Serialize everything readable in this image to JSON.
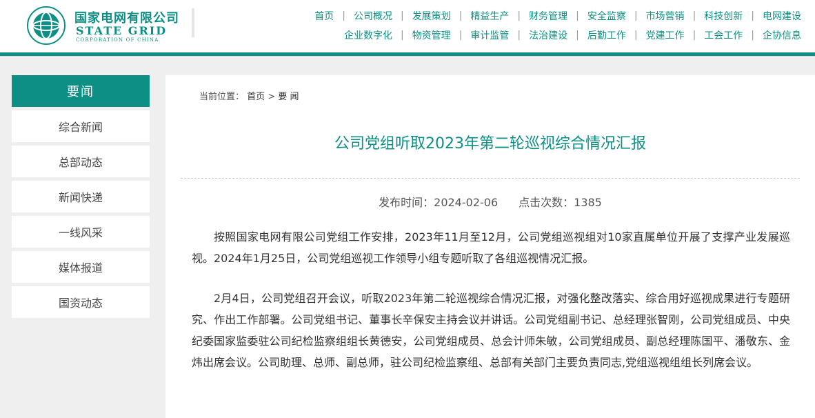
{
  "brand": {
    "name_cn": "国家电网有限公司",
    "name_en": "STATE GRID",
    "name_en_sub": "CORPORATION OF CHINA",
    "color": "#0e8f86"
  },
  "nav": {
    "row1": [
      "首页",
      "公司概况",
      "发展策划",
      "精益生产",
      "财务管理",
      "安全监察",
      "市场营销",
      "科技创新",
      "电网建设"
    ],
    "row2": [
      "企业数字化",
      "物资管理",
      "审计监管",
      "法治建设",
      "后勤工作",
      "党建工作",
      "工会工作",
      "企协信息"
    ],
    "separator": "|"
  },
  "sidebar": {
    "header": "要闻",
    "items": [
      "综合新闻",
      "总部动态",
      "新闻快递",
      "一线风采",
      "媒体报道",
      "国资动态"
    ]
  },
  "breadcrumb": {
    "label": "当前位置：",
    "home": "首页",
    "arrow": ">",
    "current": "要 闻"
  },
  "article": {
    "title": "公司党组听取2023年第二轮巡视综合情况汇报",
    "publish_label": "发布时间：",
    "publish_date": "2024-02-06",
    "clicks_label": "点击次数：",
    "clicks": "1385",
    "paragraphs": [
      "按照国家电网有限公司党组工作安排，2023年11月至12月，公司党组巡视组对10家直属单位开展了支撑产业发展巡视。2024年1月25日，公司党组巡视工作领导小组专题听取了各组巡视情况汇报。",
      "2月4日，公司党组召开会议，听取2023年第二轮巡视综合情况汇报，对强化整改落实、综合用好巡视成果进行专题研究、作出工作部署。公司党组书记、董事长辛保安主持会议并讲话。公司党组副书记、总经理张智刚，公司党组成员、中央纪委国家监委驻公司纪检监察组组长黄德安，公司党组成员、总会计师朱敏，公司党组成员、副总经理陈国平、潘敬东、金炜出席会议。公司助理、总师、副总师，驻公司纪检监察组、总部有关部门主要负责同志,党组巡视组组长列席会议。"
    ]
  }
}
